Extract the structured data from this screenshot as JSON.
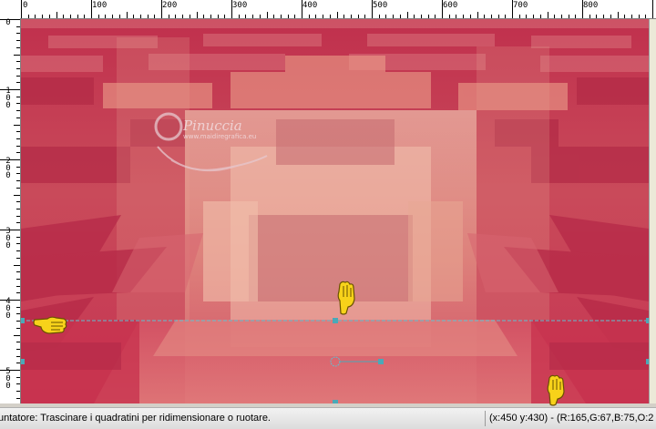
{
  "ruler": {
    "top_labels": [
      "0",
      "100",
      "200",
      "300",
      "400",
      "500",
      "600",
      "700",
      "800"
    ],
    "left_labels": [
      "0",
      "1\n0\n0",
      "2\n0\n0",
      "3\n0\n0",
      "4\n0\n0",
      "5\n0\n0"
    ]
  },
  "canvas": {
    "watermark_title": "Pinuccia",
    "watermark_url": "www.maidiregrafica.eu"
  },
  "status": {
    "message": "untatore: Trascinare i quadratini per ridimensionare o ruotare.",
    "coords": "(x:450 y:430) - (R:165,G:67,B:75,O:2"
  },
  "colors": {
    "base": "#c8334f",
    "light": "#e7a28e",
    "pale": "#f2c8b4",
    "guide": "#49b4c4"
  },
  "icons": {
    "pointer_hand": "pointing-hand-icon"
  }
}
